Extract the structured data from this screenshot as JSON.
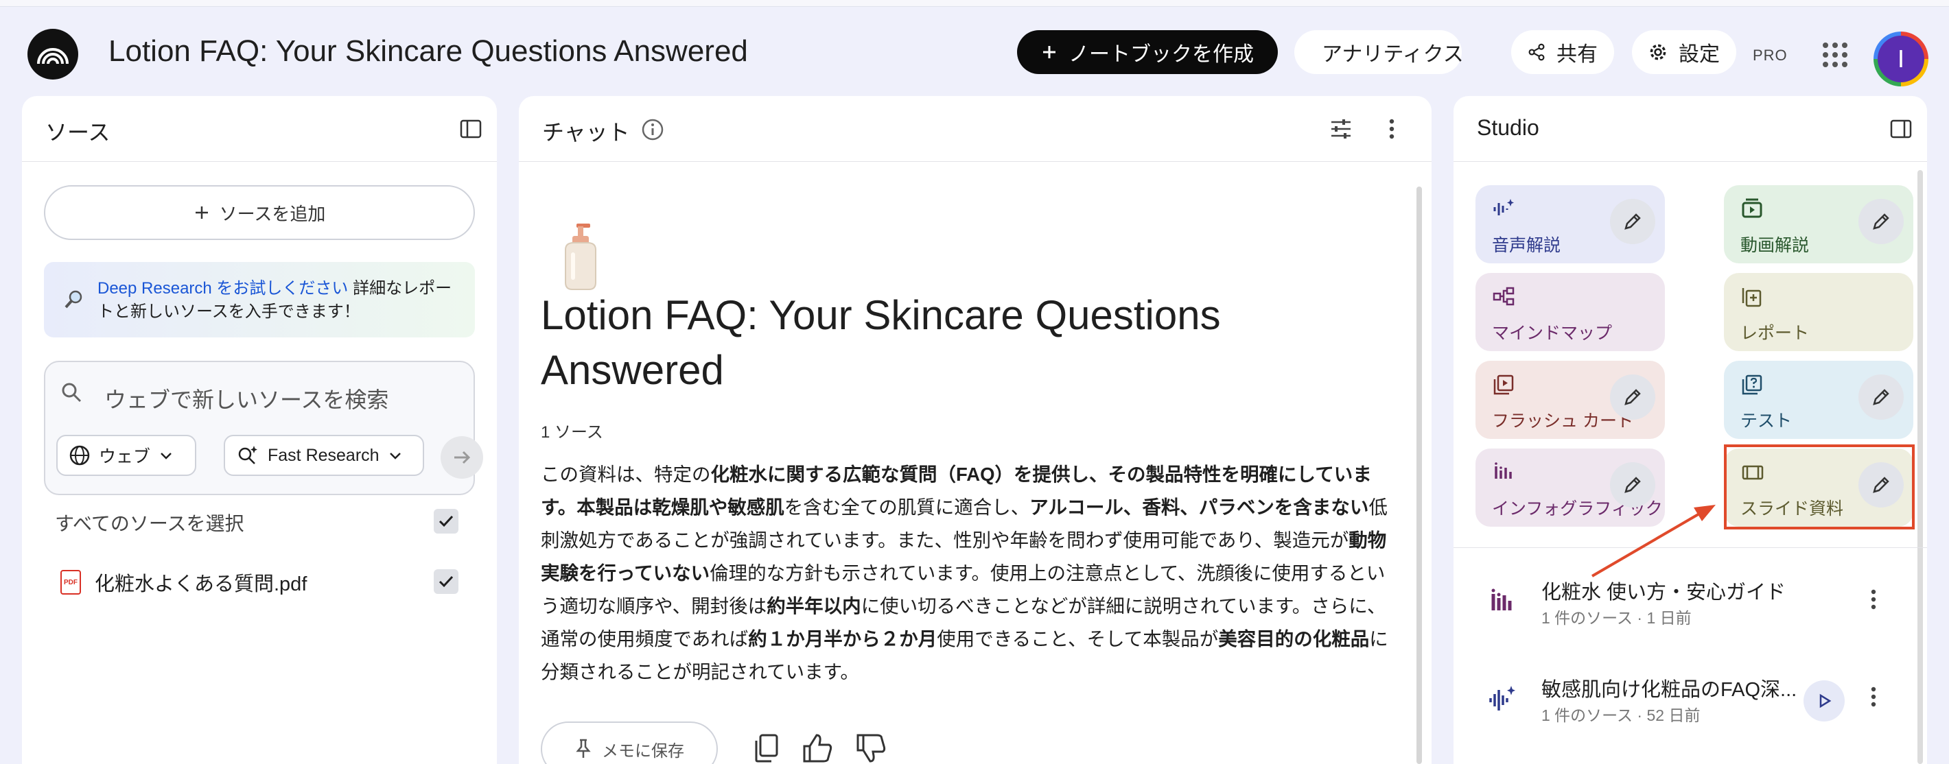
{
  "header": {
    "title": "Lotion FAQ: Your Skincare Questions Answered",
    "create_notebook": "ノートブックを作成",
    "analytics": "アナリティクス",
    "share": "共有",
    "settings": "設定",
    "pro": "PRO",
    "avatar_initial": "I"
  },
  "sources": {
    "title": "ソース",
    "add_source": "ソースを追加",
    "deep_research_link": "Deep Research をお試しください",
    "deep_research_text_1": " 詳細なレポー",
    "deep_research_text_2": "トと新しいソースを入手できます！",
    "search_placeholder": "ウェブで新しいソースを検索",
    "web_chip": "ウェブ",
    "research_chip": "Fast Research",
    "select_all": "すべてのソースを選択",
    "files": [
      {
        "name": "化粧水よくある質問.pdf",
        "checked": true
      }
    ]
  },
  "chat": {
    "title": "チャット",
    "notebook_title": "Lotion FAQ: Your Skincare Questions Answered",
    "source_count": "1 ソース",
    "summary": [
      {
        "t": "この資料は、特定の",
        "b": false
      },
      {
        "t": "化粧水に関する広範な質問（FAQ）を提供し、その製品特性を明確にしています。本製品は乾燥肌や敏感肌",
        "b": true
      },
      {
        "t": "を含む全ての肌質に適合し、",
        "b": false
      },
      {
        "t": "アルコール、香料、パラベンを含まない",
        "b": true
      },
      {
        "t": "低刺激処方であることが強調されています。また、性別や年齢を問わず使用可能であり、製造元が",
        "b": false
      },
      {
        "t": "動物実験を行っていない",
        "b": true
      },
      {
        "t": "倫理的な方針も示されています。使用上の注意点として、洗顔後に使用するという適切な順序や、開封後は",
        "b": false
      },
      {
        "t": "約半年以内",
        "b": true
      },
      {
        "t": "に使い切るべきことなどが詳細に説明されています。さらに、通常の使用頻度であれば",
        "b": false
      },
      {
        "t": "約１か月半から２か月",
        "b": true
      },
      {
        "t": "使用できること、そして本製品が",
        "b": false
      },
      {
        "t": "美容目的の化粧品",
        "b": true
      },
      {
        "t": "に分類されることが明記されています。",
        "b": false
      }
    ],
    "save_memo": "メモに保存"
  },
  "studio": {
    "title": "Studio",
    "tiles": {
      "audio": "音声解説",
      "video": "動画解説",
      "mindmap": "マインドマップ",
      "report": "レポート",
      "flashcards": "フラッシュ カード",
      "test": "テスト",
      "infographic": "インフォグラフィック",
      "slides": "スライド資料"
    },
    "items": [
      {
        "title": "化粧水 使い方・安心ガイド",
        "sub": "1 件のソース · 1 日前"
      },
      {
        "title": "敏感肌向け化粧品のFAQ深...",
        "sub": "1 件のソース · 52 日前"
      }
    ]
  },
  "colors": {
    "accent": "#1a56d6",
    "highlight": "#e04a2b",
    "background": "#eff0fb"
  }
}
